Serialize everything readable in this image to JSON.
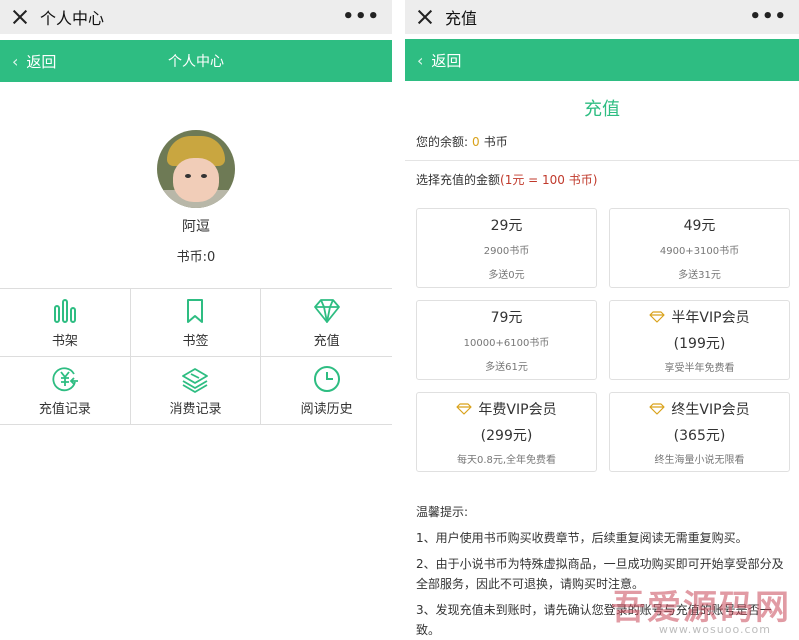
{
  "left": {
    "window_title": "个人中心",
    "menu_dots": "•••",
    "back_label": "返回",
    "header_title": "个人中心",
    "username": "阿逗",
    "coins": "书币:0",
    "menu": [
      {
        "label": "书架",
        "icon": "bars-icon"
      },
      {
        "label": "书签",
        "icon": "bookmark-icon"
      },
      {
        "label": "充值",
        "icon": "diamond-icon"
      },
      {
        "label": "充值记录",
        "icon": "yen-record-icon"
      },
      {
        "label": "消费记录",
        "icon": "coins-stack-icon"
      },
      {
        "label": "阅读历史",
        "icon": "clock-icon"
      }
    ]
  },
  "right": {
    "window_title": "充值",
    "menu_dots": "•••",
    "back_label": "返回",
    "page_title": "充值",
    "balance_label": "您的余额:",
    "balance_value": "0",
    "balance_unit": "书币",
    "choose_label": "选择充值的金额",
    "rate": "(1元 = 100 书币)",
    "plans": [
      {
        "price": "29元",
        "coins": "2900书币",
        "bonus": "多送0元"
      },
      {
        "price": "49元",
        "coins": "4900+3100书币",
        "bonus": "多送31元"
      },
      {
        "price": "79元",
        "coins": "10000+6100书币",
        "bonus": "多送61元"
      }
    ],
    "vip": [
      {
        "name": "半年VIP会员",
        "price": "(199元)",
        "note": "享受半年免费看"
      },
      {
        "name": "年费VIP会员",
        "price": "(299元)",
        "note": "每天0.8元,全年免费看"
      },
      {
        "name": "终生VIP会员",
        "price": "(365元)",
        "note": "终生海量小说无限看"
      }
    ],
    "tips_title": "温馨提示:",
    "tips": [
      "1、用户使用书币购买收费章节，后续重复阅读无需重复购买。",
      "2、由于小说书币为特殊虚拟商品，一旦成功购买即可开始享受部分及全部服务，因此不可退换，请购买时注意。",
      "3、发现充值未到账时，请先确认您登录的账号与充值的账号是否一致。"
    ],
    "watermark_big": "吾爱源码网",
    "watermark_small": "www.wosuoo.com"
  },
  "colors": {
    "accent": "#2ebd82",
    "balance": "#d9a21b",
    "rate": "#c0392b"
  }
}
